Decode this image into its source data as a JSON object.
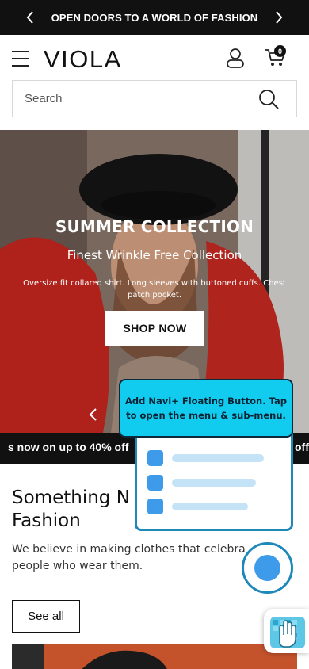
{
  "announcement": {
    "text": "OPEN DOORS TO A WORLD OF FASHION"
  },
  "header": {
    "brand": "VIOLA",
    "cart_count": "0"
  },
  "search": {
    "placeholder": "Search"
  },
  "hero": {
    "title": "SUMMER COLLECTION",
    "subtitle": "Finest Wrinkle Free Collection",
    "description": "Oversize fit collared shirt. Long sleeves with buttoned cuffs. Chest patch pocket.",
    "cta": "SHOP NOW"
  },
  "ticker": {
    "text": "s now on up to 40% off",
    "text_next": "off"
  },
  "section": {
    "heading_line1": "Something N",
    "heading_line2": "Fashion",
    "body_line1": "We believe in making clothes that celebra",
    "body_line2": "people who wear them.",
    "button": "See all"
  },
  "navi_tooltip": {
    "text": "Add Navi+ Floating Button. Tap to open the menu & sub-menu."
  },
  "colors": {
    "accent": "#1e88b8",
    "tooltip_bg": "#11ccee",
    "menu_square": "#3d9be9",
    "dark": "#111111"
  }
}
